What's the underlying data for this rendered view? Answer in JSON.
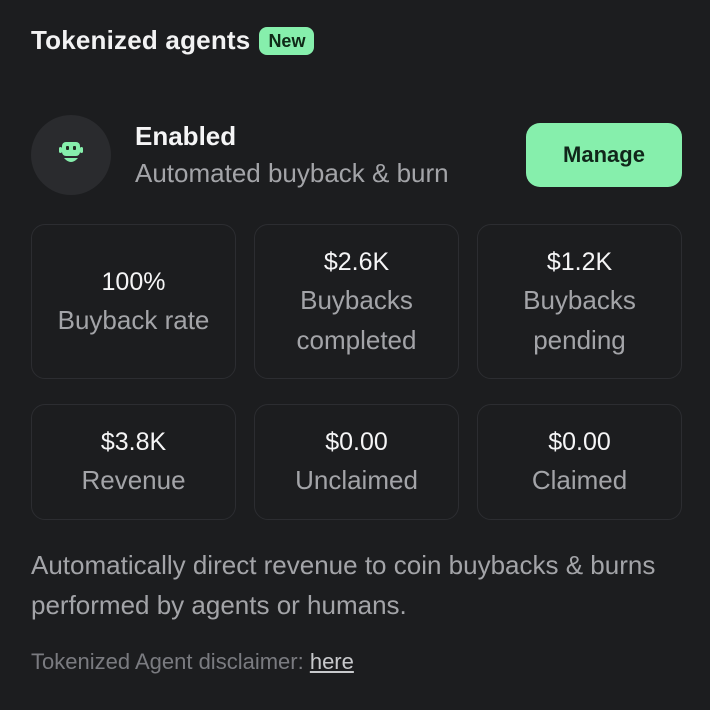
{
  "header": {
    "title": "Tokenized agents",
    "badge": "New"
  },
  "status": {
    "icon": "robot-icon",
    "title": "Enabled",
    "subtitle": "Automated buyback & burn",
    "manage_label": "Manage"
  },
  "stats": [
    {
      "value": "100%",
      "label": "Buyback rate"
    },
    {
      "value": "$2.6K",
      "label": "Buybacks completed"
    },
    {
      "value": "$1.2K",
      "label": "Buybacks pending"
    },
    {
      "value": "$3.8K",
      "label": "Revenue"
    },
    {
      "value": "$0.00",
      "label": "Unclaimed"
    },
    {
      "value": "$0.00",
      "label": "Claimed"
    }
  ],
  "description": "Automatically direct revenue to coin buybacks & burns performed by agents or humans.",
  "disclaimer": {
    "text": "Tokenized Agent disclaimer: ",
    "link": "here"
  },
  "colors": {
    "accent": "#86efac",
    "background": "#1c1d1f"
  }
}
